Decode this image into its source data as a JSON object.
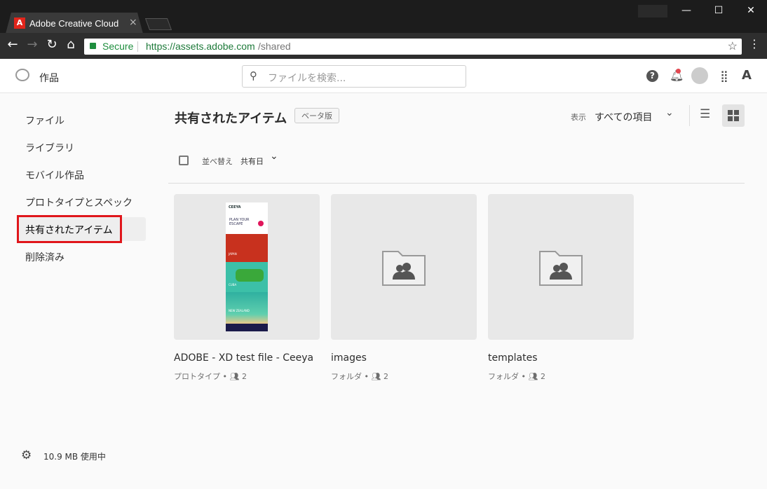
{
  "browser": {
    "tab_title": "Adobe Creative Cloud",
    "tab_close": "×",
    "secure_label": "Secure",
    "url_host": "https://assets.adobe.com",
    "url_path": "/shared",
    "window_controls": {
      "minimize": "—",
      "maximize": "☐",
      "close": "✕"
    }
  },
  "app": {
    "title": "作品",
    "search_placeholder": "ファイルを検索..."
  },
  "sidebar": {
    "items": [
      {
        "label": "ファイル"
      },
      {
        "label": "ライブラリ"
      },
      {
        "label": "モバイル作品"
      },
      {
        "label": "プロトタイプとスペック"
      },
      {
        "label": "共有されたアイテム",
        "selected": true
      },
      {
        "label": "削除済み"
      }
    ],
    "storage": "10.9 MB 使用中"
  },
  "main": {
    "title": "共有されたアイテム",
    "badge": "ベータ版",
    "view_label": "表示",
    "view_value": "すべての項目",
    "sort_label": "並べ替え",
    "sort_value": "共有日",
    "items": [
      {
        "name": "ADOBE - XD test file - Ceeya",
        "type": "プロトタイプ",
        "shared": "2",
        "thumb_texts": [
          "CEEYA",
          "PLAN YOUR ESCAPE",
          "JAPAN",
          "CUBA",
          "NEW ZEALAND"
        ]
      },
      {
        "name": "images",
        "type": "フォルダ",
        "shared": "2"
      },
      {
        "name": "templates",
        "type": "フォルダ",
        "shared": "2"
      }
    ]
  },
  "colors": {
    "accent_red": "#e0161b",
    "adobe_red": "#e1251b",
    "notification": "#e34850"
  }
}
